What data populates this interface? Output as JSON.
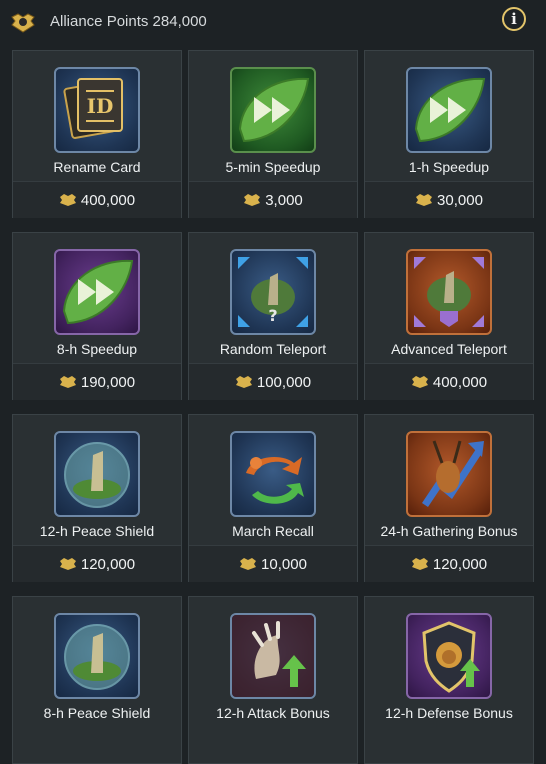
{
  "header": {
    "title": "Alliance Points 284,000",
    "info_label": "i",
    "icon": "alliance-crest-icon"
  },
  "items": [
    {
      "name": "Rename Card",
      "price": "400,000",
      "icon": "rename-card-icon",
      "bg": "bg-blue"
    },
    {
      "name": "5-min Speedup",
      "price": "3,000",
      "icon": "speedup-icon",
      "bg": "bg-green"
    },
    {
      "name": "1-h Speedup",
      "price": "30,000",
      "icon": "speedup-icon",
      "bg": "bg-blue"
    },
    {
      "name": "8-h Speedup",
      "price": "190,000",
      "icon": "speedup-icon",
      "bg": "bg-purple"
    },
    {
      "name": "Random Teleport",
      "price": "100,000",
      "icon": "random-teleport-icon",
      "bg": "bg-blue"
    },
    {
      "name": "Advanced Teleport",
      "price": "400,000",
      "icon": "advanced-teleport-icon",
      "bg": "bg-orange"
    },
    {
      "name": "12-h Peace Shield",
      "price": "120,000",
      "icon": "peace-shield-icon",
      "bg": "bg-blue"
    },
    {
      "name": "March Recall",
      "price": "10,000",
      "icon": "march-recall-icon",
      "bg": "bg-blue"
    },
    {
      "name": "24-h Gathering Bonus",
      "price": "120,000",
      "icon": "gathering-bonus-icon",
      "bg": "bg-orange"
    },
    {
      "name": "8-h Peace Shield",
      "price": "",
      "icon": "peace-shield-icon",
      "bg": "bg-blue"
    },
    {
      "name": "12-h Attack Bonus",
      "price": "",
      "icon": "attack-bonus-icon",
      "bg": "bg-blue"
    },
    {
      "name": "12-h Defense Bonus",
      "price": "",
      "icon": "defense-bonus-icon",
      "bg": "bg-purple"
    }
  ],
  "colors": {
    "accent_gold": "#e2c46a",
    "card_bg": "#2a3033",
    "page_bg": "#1d2225"
  }
}
